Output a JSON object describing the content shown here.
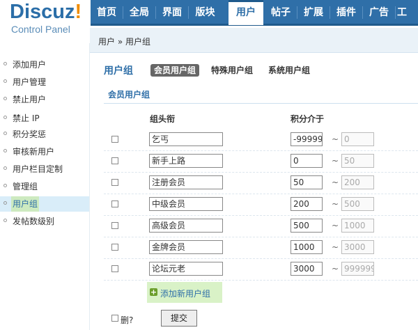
{
  "logo": {
    "title_main": "Discuz",
    "title_mark": "!",
    "subtitle": "Control Panel"
  },
  "nav": [
    "首页",
    "全局",
    "界面",
    "版块",
    "用户",
    "帖子",
    "扩展",
    "插件",
    "广告",
    "工"
  ],
  "nav_active": "用户",
  "breadcrumb": "用户 » 用户组",
  "sidebar": [
    "添加用户",
    "用户管理",
    "禁止用户",
    "禁止 IP",
    "积分奖惩",
    "审核新用户",
    "用户栏目定制",
    "管理组",
    "用户组",
    "发帖数级别"
  ],
  "sidebar_active": "用户组",
  "page_title": "用户组",
  "tabs": [
    "会员用户组",
    "特殊用户组",
    "系统用户组"
  ],
  "tab_active": "会员用户组",
  "section_title": "会员用户组",
  "columns": {
    "name": "组头衔",
    "range": "积分介于"
  },
  "groups": [
    {
      "name": "乞丐",
      "min": "-99999",
      "max": "0"
    },
    {
      "name": "新手上路",
      "min": "0",
      "max": "50"
    },
    {
      "name": "注册会员",
      "min": "50",
      "max": "200"
    },
    {
      "name": "中级会员",
      "min": "200",
      "max": "500"
    },
    {
      "name": "高级会员",
      "min": "500",
      "max": "1000"
    },
    {
      "name": "金牌会员",
      "min": "1000",
      "max": "3000"
    },
    {
      "name": "论坛元老",
      "min": "3000",
      "max": "999999"
    }
  ],
  "range_sep": "~",
  "add_group": "添加新用户组",
  "delete_label": "删?",
  "submit_label": "提交",
  "colors": {
    "nav_bg": "#2f6fa8",
    "accent": "#2f6fa8",
    "logo_orange": "#f08c00",
    "add_bg": "#d9f2c7"
  }
}
